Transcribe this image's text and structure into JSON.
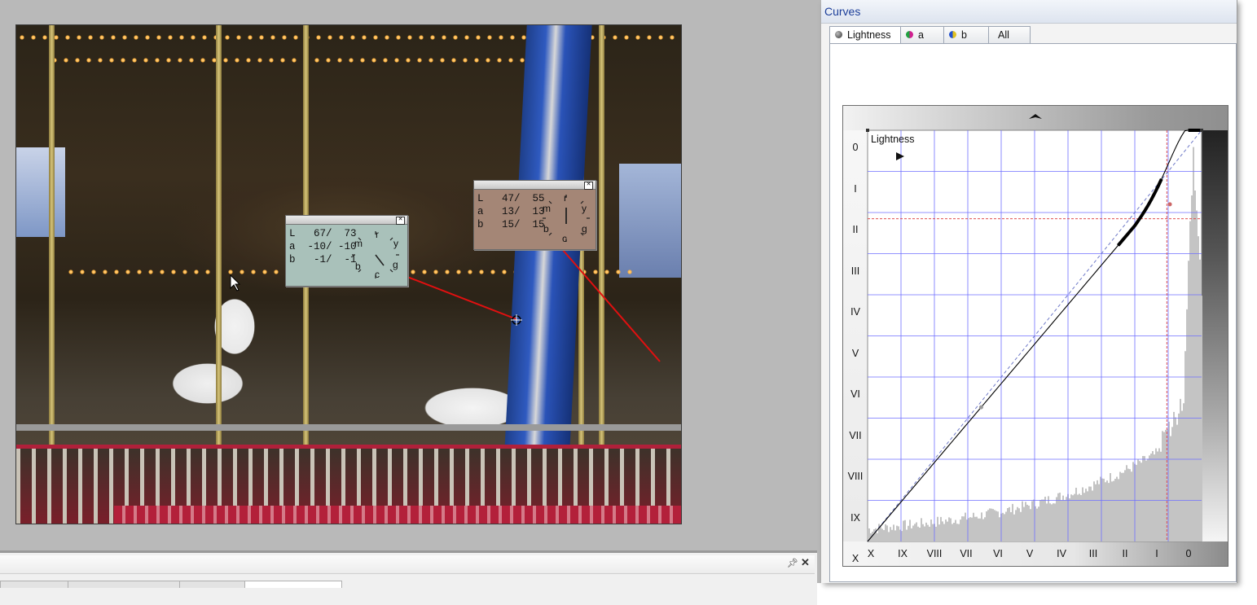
{
  "workspace": {
    "probes": [
      {
        "L": "L   67/  73",
        "a": "a  -10/ -10",
        "b": "b   -1/  -1",
        "bg": "#a9c1ba",
        "dial": {
          "m": "m",
          "r": "r",
          "y": "y",
          "g": "g",
          "c": "c",
          "b": "b"
        }
      },
      {
        "L": "L   47/  55",
        "a": "a   13/  13",
        "b": "b   15/  15",
        "bg": "#a48676",
        "dial": {
          "m": "m",
          "r": "r",
          "y": "y",
          "g": "g",
          "c": "c",
          "b": "b"
        }
      }
    ]
  },
  "curves_panel": {
    "title": "Curves",
    "tabs": [
      {
        "label": "Lightness",
        "icon": "lightness-sphere-icon",
        "active": true
      },
      {
        "label": "a",
        "icon": "a-channel-icon",
        "active": false
      },
      {
        "label": "b",
        "icon": "b-channel-icon",
        "active": false
      },
      {
        "label": "All",
        "icon": "",
        "active": false
      }
    ],
    "graph": {
      "channel_label": "Lightness",
      "y_labels": [
        "0",
        "I",
        "II",
        "III",
        "IV",
        "V",
        "VI",
        "VII",
        "VIII",
        "IX",
        "X"
      ],
      "x_labels": [
        "X",
        "IX",
        "VIII",
        "VII",
        "VI",
        "V",
        "IV",
        "III",
        "II",
        "I",
        "0"
      ],
      "grid_color": "#6f6fff",
      "guide_color": "#e05050"
    }
  },
  "bottom_panel": {
    "pin_icon": "pin-icon",
    "close_icon": "close-icon"
  }
}
